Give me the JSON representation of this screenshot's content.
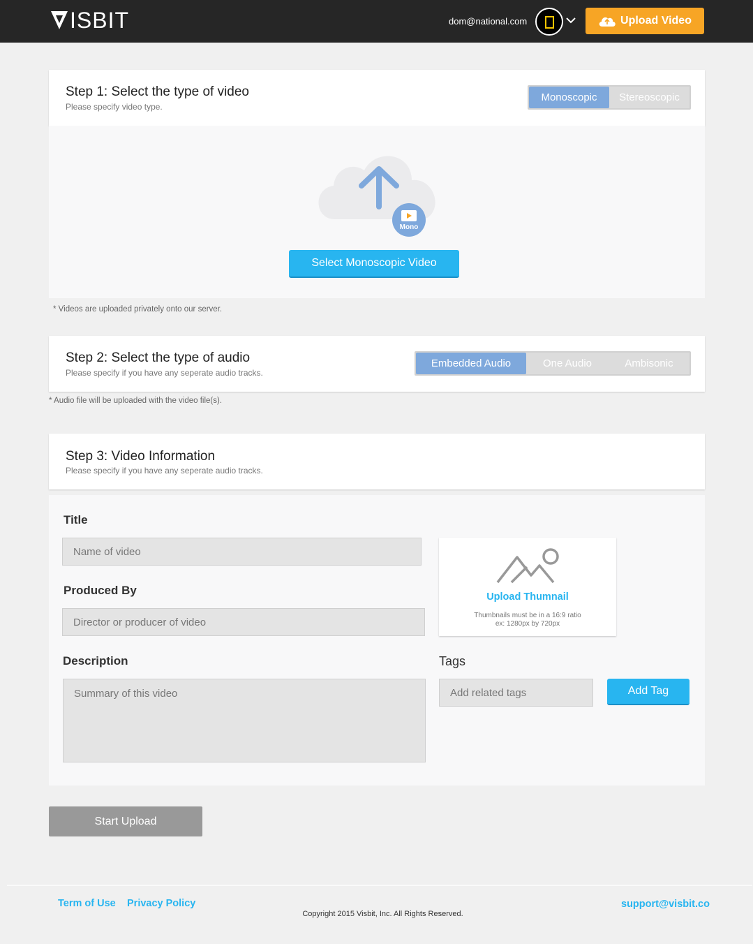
{
  "header": {
    "logo_text": "ISBIT",
    "user_email": "dom@national.com",
    "upload_label": "Upload Video"
  },
  "step1": {
    "title": "Step 1:  Select the type of video",
    "subtitle": "Please specify video type.",
    "options": [
      "Monoscopic",
      "Stereoscopic"
    ],
    "selected": "Monoscopic",
    "badge": "Mono",
    "select_button": "Select Monoscopic Video",
    "note": "* Videos are uploaded privately onto our server."
  },
  "step2": {
    "title": "Step 2:  Select the type of audio",
    "subtitle": "Please specify if you have any seperate audio tracks.",
    "options": [
      "Embedded Audio",
      "One Audio",
      "Ambisonic"
    ],
    "selected": "Embedded Audio",
    "note": "* Audio file will be uploaded with the video file(s)."
  },
  "step3": {
    "title": "Step 3:  Video Information",
    "subtitle": "Please specify if you have any seperate audio tracks.",
    "title_label": "Title",
    "title_placeholder": "Name of video",
    "produced_label": "Produced By",
    "produced_placeholder": "Director or producer of video",
    "description_label": "Description",
    "description_placeholder": "Summary of this video",
    "thumbnail_title": "Upload Thumnail",
    "thumbnail_note_1": "Thumbnails must be in a 16:9 ratio",
    "thumbnail_note_2": "ex: 1280px by 720px",
    "tags_label": "Tags",
    "tags_placeholder": "Add related tags",
    "add_tag_button": "Add Tag"
  },
  "start_upload": "Start Upload",
  "footer": {
    "terms": "Term of Use",
    "privacy": "Privacy Policy",
    "copyright": "Copyright 2015 Visbit, Inc. All Rights Reserved.",
    "support": "support@visbit.co"
  },
  "colors": {
    "accent_blue": "#28b5f0",
    "segment_active": "#7ea8dc",
    "upload_orange": "#f7a525",
    "header_bg": "#262626"
  },
  "icons": [
    "logo-v-icon",
    "national-geographic-icon",
    "chevron-down-icon",
    "cloud-upload-icon",
    "upload-arrow-icon",
    "video-badge-icon",
    "mountain-image-icon"
  ]
}
